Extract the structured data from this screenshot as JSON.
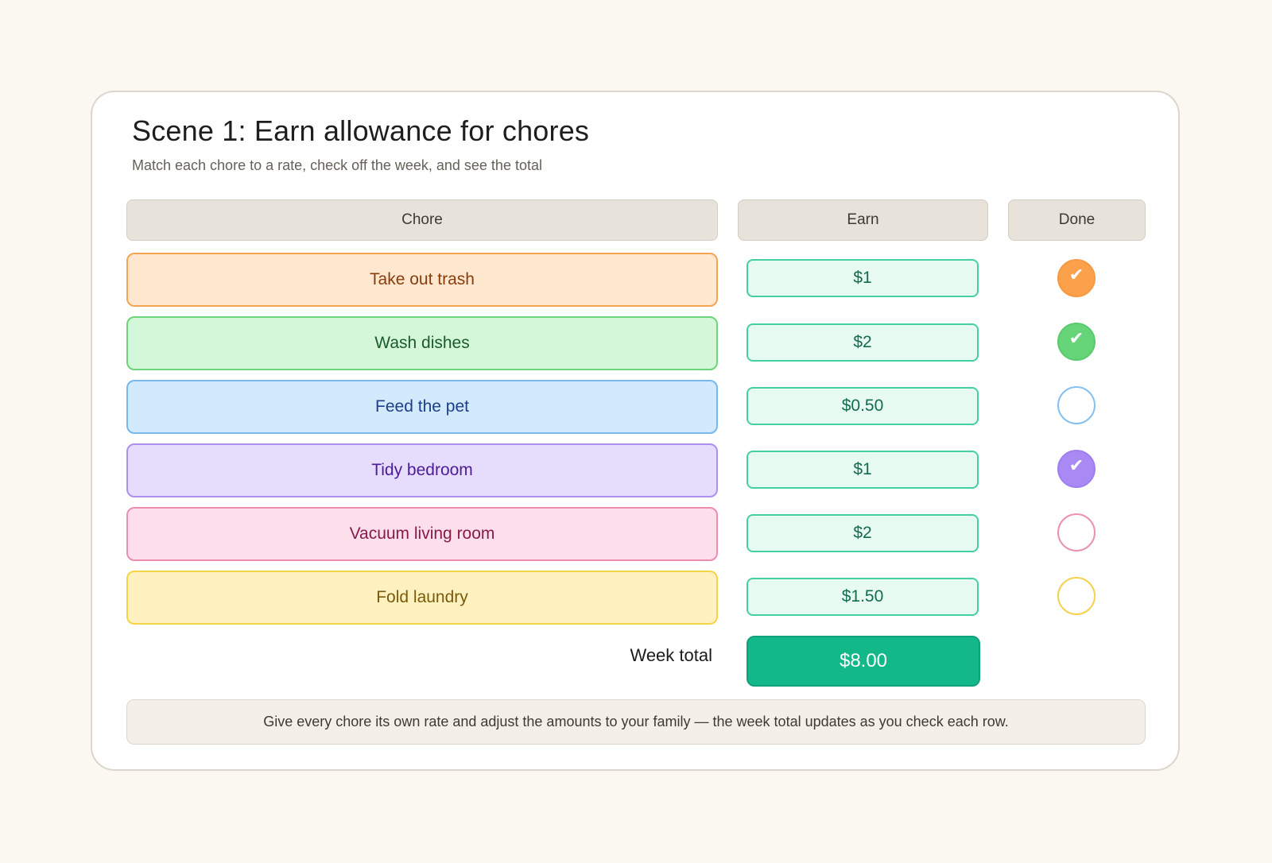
{
  "scene": {
    "title": "Scene 1: Earn allowance for chores",
    "subtitle": "Match each chore to a rate, check off the week, and see the total"
  },
  "headers": {
    "chore": "Chore",
    "earn": "Earn",
    "done": "Done"
  },
  "rows": [
    {
      "chore": "Take out trash",
      "earn": "$1",
      "done": true,
      "done_icon": "checkmark-icon",
      "colors": {
        "bg": "#ffe8cf",
        "border": "#f5a550",
        "text": "#8a3b0c",
        "check_fill": "#fba04b",
        "check_border": "#f59a43"
      }
    },
    {
      "chore": "Wash dishes",
      "earn": "$2",
      "done": true,
      "done_icon": "checkmark-icon",
      "colors": {
        "bg": "#d4f7d9",
        "border": "#6bd67a",
        "text": "#1b5a2a",
        "check_fill": "#66d479",
        "check_border": "#5cc96e"
      }
    },
    {
      "chore": "Feed the pet",
      "earn": "$0.50",
      "done": false,
      "done_icon": "empty-circle-icon",
      "colors": {
        "bg": "#d3eafc",
        "border": "#75b9ef",
        "text": "#1d3f8a",
        "check_fill": "#ffffff",
        "check_border": "#86c0ee"
      }
    },
    {
      "chore": "Tidy bedroom",
      "earn": "$1",
      "done": true,
      "done_icon": "checkmark-icon",
      "colors": {
        "bg": "#e6dcfc",
        "border": "#ab90f0",
        "text": "#4b1c9a",
        "check_fill": "#a98af4",
        "check_border": "#9f7ff0"
      }
    },
    {
      "chore": "Vacuum living room",
      "earn": "$2",
      "done": false,
      "done_icon": "empty-circle-icon",
      "colors": {
        "bg": "#fddfec",
        "border": "#ee8cb2",
        "text": "#861a4c",
        "check_fill": "#ffffff",
        "check_border": "#eb92b4"
      }
    },
    {
      "chore": "Fold laundry",
      "earn": "$1.50",
      "done": false,
      "done_icon": "empty-circle-icon",
      "colors": {
        "bg": "#fff2c0",
        "border": "#f5d548",
        "text": "#7a5a08",
        "check_fill": "#ffffff",
        "check_border": "#f3d24e"
      }
    }
  ],
  "total": {
    "label": "Week total",
    "value": "$8.00"
  },
  "note": "Give every chore its own rate and adjust the amounts to your family — the week total updates as you check each row.",
  "check_glyph": "✔"
}
